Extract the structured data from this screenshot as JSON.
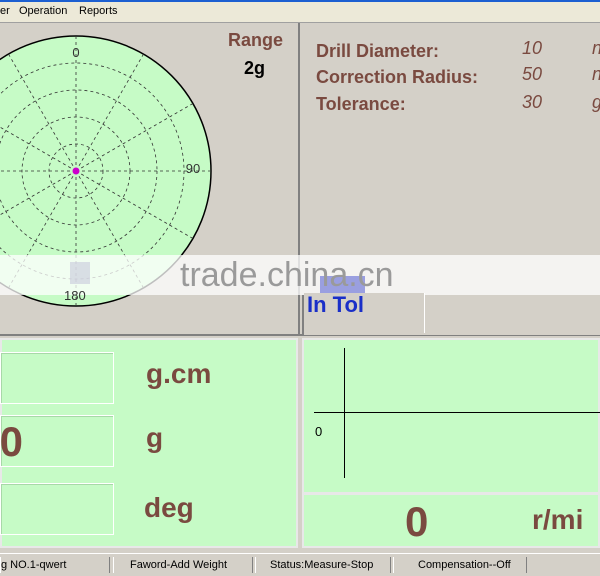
{
  "menubar": {
    "items": [
      "er",
      "Operation",
      "Reports"
    ]
  },
  "polar": {
    "labels": {
      "top": "0",
      "right": "90",
      "bottom": "180"
    },
    "marker_color": "#cc00cc",
    "fill_color": "#c6fbc6"
  },
  "range": {
    "label": "Range",
    "value": "2g"
  },
  "params": [
    {
      "label": "Drill Diameter:",
      "value": "10",
      "unit": "n"
    },
    {
      "label": "Correction Radius:",
      "value": "50",
      "unit": "n"
    },
    {
      "label": "Tolerance:",
      "value": "30",
      "unit": "g"
    }
  ],
  "watermark": "trade.china.cn",
  "status_indicator": "In Tol",
  "readings": {
    "row1": {
      "value": "",
      "unit": "g.cm"
    },
    "row2": {
      "value": ".0",
      "unit": "g"
    },
    "row3": {
      "value": "",
      "unit": "deg"
    }
  },
  "plot": {
    "zero_label": "0"
  },
  "speed": {
    "value": "0",
    "unit": "r/mi"
  },
  "statusbar": {
    "items": [
      "g NO.1-qwert",
      "Faword-Add Weight",
      "Status:Measure-Stop",
      "Compensation--Off"
    ]
  },
  "colors": {
    "label_brown": "#7a4a40",
    "green_bg": "#c6fbc6",
    "blue_text": "#1a2fc8"
  }
}
